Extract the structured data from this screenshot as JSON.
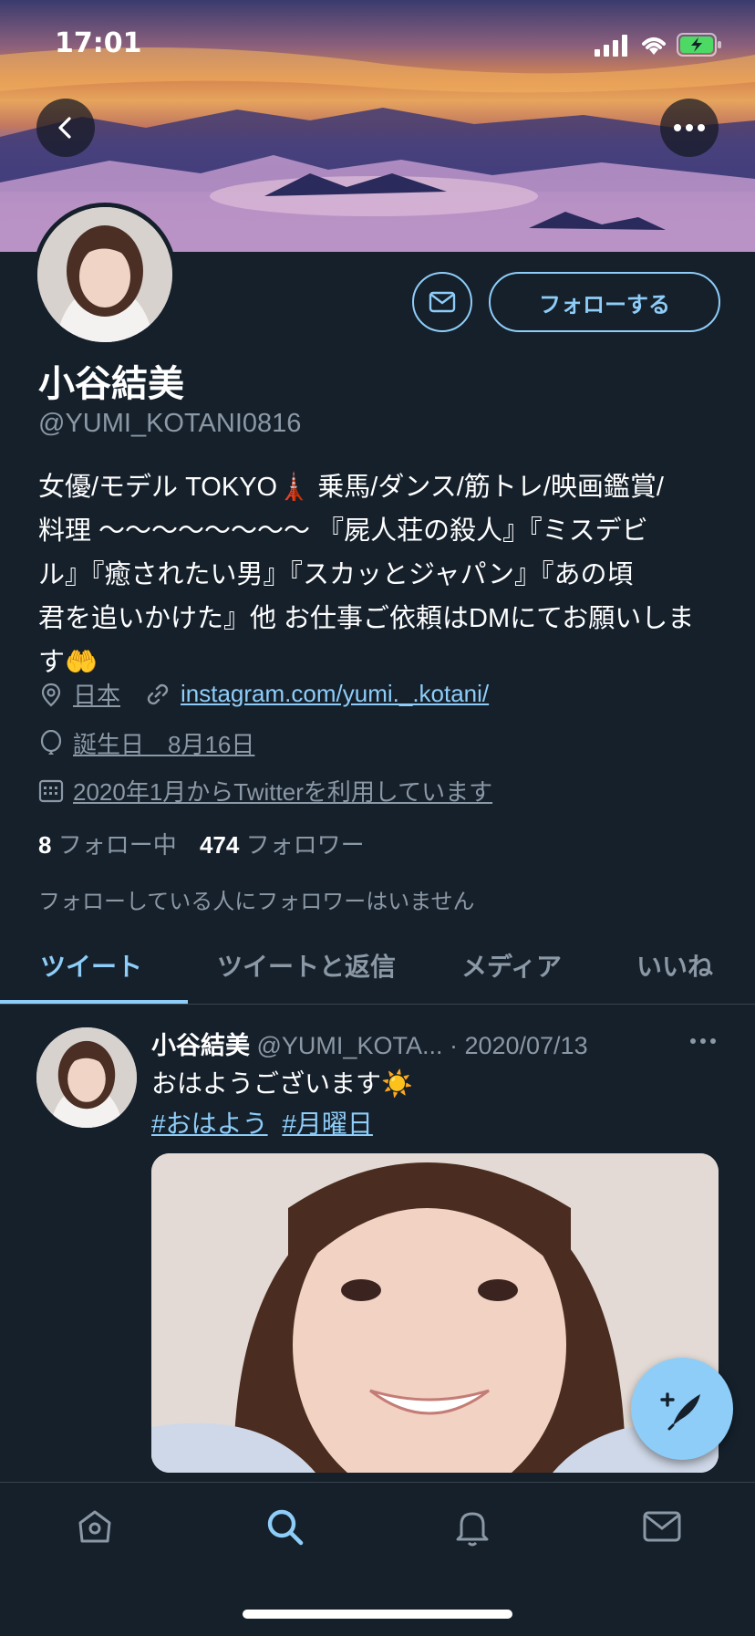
{
  "status_bar": {
    "time": "17:01"
  },
  "profile": {
    "name": "小谷結美",
    "handle": "@YUMI_KOTANI0816",
    "follow_label": "フォローする",
    "bio": "女優/モデル TOKYO🗼 乗馬/ダンス/筋トレ/映画鑑賞/\n料理 〜〜〜〜〜〜〜〜 『屍人荘の殺人』『ミスデビ\nル』『癒されたい男』『スカッとジャパン』『あの頃\n君を追いかけた』他 お仕事ご依頼はDMにてお願いしま\nす🤲",
    "location": "日本",
    "website": "instagram.com/yumi._.kotani/",
    "birthday": "誕生日　8月16日",
    "joined": "2020年1月からTwitterを利用しています",
    "following_count": "8",
    "following_label": "フォロー中",
    "followers_count": "474",
    "followers_label": "フォロワー",
    "no_mutual": "フォローしている人にフォロワーはいません"
  },
  "tabs": [
    {
      "label": "ツイート",
      "active": true
    },
    {
      "label": "ツイートと返信",
      "active": false
    },
    {
      "label": "メディア",
      "active": false
    },
    {
      "label": "いいね",
      "active": false
    }
  ],
  "tweet": {
    "author_name": "小谷結美",
    "author_handle": "@YUMI_KOTA...",
    "date": "· 2020/07/13",
    "text": "おはようございます☀️",
    "hashtags": [
      "#おはよう",
      "#月曜日"
    ]
  },
  "colors": {
    "background": "#15202b",
    "accent": "#8ecdf8",
    "secondary_text": "#8b98a5"
  }
}
